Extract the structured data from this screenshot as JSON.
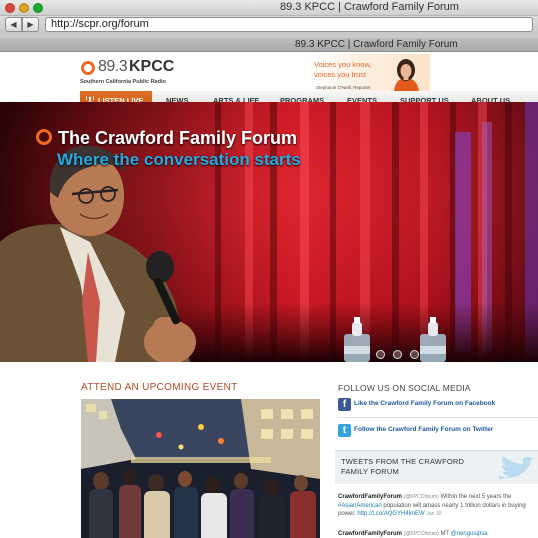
{
  "browser": {
    "window_title": "89.3 KPCC | Crawford Family Forum",
    "url": "http://scpr.org/forum",
    "tab_title": "89.3 KPCC | Crawford Family Forum",
    "back_label": "◀",
    "forward_label": "▶"
  },
  "header": {
    "logo_freq": "89.3",
    "logo_name": "KPCC",
    "logo_tagline": "Southern California Public Radio",
    "ad": {
      "line1": "Voices you know,",
      "line2": "voices you trust",
      "credit": "Stephanie O'Neill, Reporter"
    }
  },
  "nav": {
    "listen": "LISTEN LIVE",
    "items": [
      "NEWS",
      "ARTS & LIFE",
      "PROGRAMS",
      "EVENTS",
      "SUPPORT US",
      "ABOUT US"
    ]
  },
  "hero": {
    "title": "The Crawford Family Forum",
    "subtitle": "Where the conversation starts",
    "slide_count": 3
  },
  "events": {
    "heading": "ATTEND AN UPCOMING EVENT"
  },
  "social": {
    "heading": "FOLLOW US ON SOCIAL MEDIA",
    "facebook": "Like the Crawford Family Forum on Facebook",
    "twitter": "Follow the Crawford Family Forum on Twitter",
    "tweets_heading": "TWEETS FROM THE CRAWFORD FAMILY FORUM",
    "tweets": [
      {
        "author": "CrawfordFamilyForum",
        "handle": "(@KPCCforum)",
        "text_a": "Within the next 5 years the",
        "tag": "#AsianAmerican",
        "text_b": "population will amass nearly 1 trillion dollars in buying power.",
        "link": "http://t.co/AQGYH4knEW",
        "date": "Jan 30"
      },
      {
        "author": "CrawfordFamilyForum",
        "handle": "(@KPCCforum)",
        "text_a": "MT",
        "tag": "@nengusipsa",
        "text_b": "",
        "link": "",
        "date": ""
      }
    ]
  },
  "colors": {
    "brand_orange": "#f26a21",
    "hero_subtitle_blue": "#25a9e0",
    "section_rust": "#b24a23",
    "link_blue": "#1c5a9a"
  }
}
